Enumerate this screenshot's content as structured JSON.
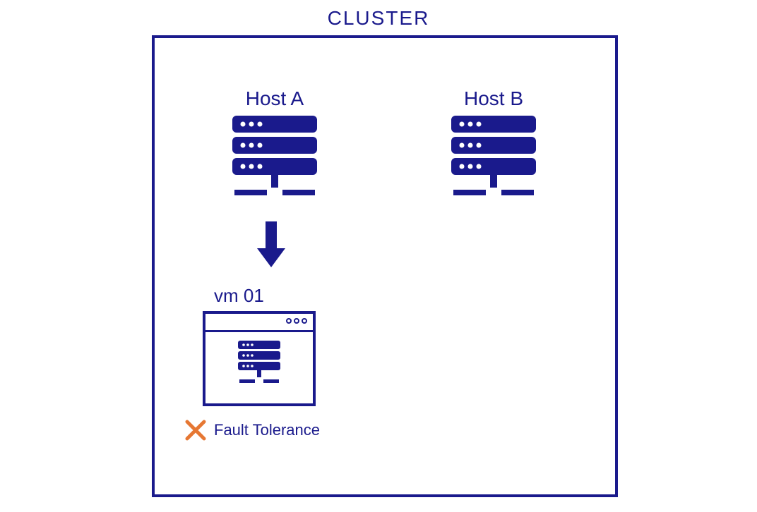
{
  "cluster": {
    "title": "CLUSTER",
    "hosts": [
      {
        "label": "Host A"
      },
      {
        "label": "Host B"
      }
    ],
    "vm": {
      "label": "vm 01",
      "fault_tolerance_label": "Fault Tolerance",
      "fault_tolerance_enabled": false
    },
    "colors": {
      "primary": "#1a1a8c",
      "error": "#e67733"
    }
  }
}
